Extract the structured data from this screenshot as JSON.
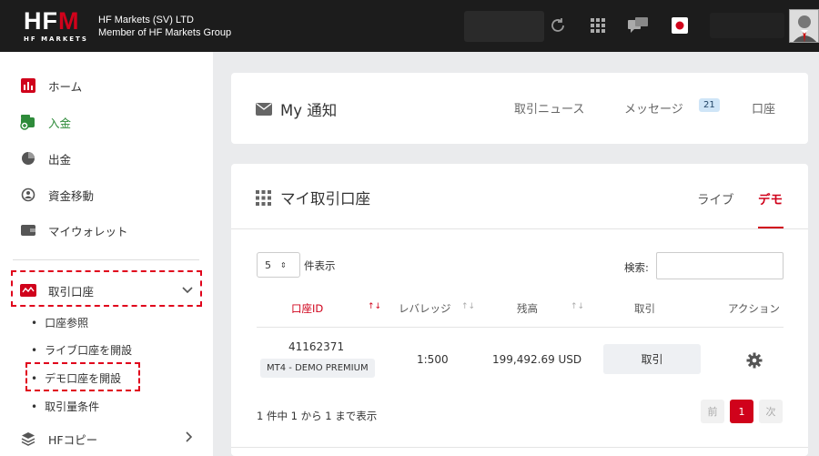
{
  "header": {
    "logo_text_main": "HFM",
    "logo_text_sub": "HF MARKETS",
    "company_line1": "HF Markets (SV) LTD",
    "company_line2": "Member of HF Markets Group",
    "icons": [
      "refresh-icon",
      "apps-grid-icon",
      "chat-icon",
      "japan-flag-icon",
      "avatar"
    ]
  },
  "sidebar": {
    "items": [
      {
        "label": "ホーム",
        "icon": "bar-chart-icon",
        "color": "#d0021b"
      },
      {
        "label": "入金",
        "icon": "deposit-icon",
        "color": "#2e8b3a"
      },
      {
        "label": "出金",
        "icon": "withdraw-icon",
        "color": "#555555"
      },
      {
        "label": "資金移動",
        "icon": "transfer-icon",
        "color": "#555555"
      },
      {
        "label": "マイウォレット",
        "icon": "wallet-icon",
        "color": "#555555"
      },
      {
        "label": "取引口座",
        "icon": "trading-account-icon",
        "color": "#d0021b"
      },
      {
        "label": "HFコピー",
        "icon": "layers-icon",
        "color": "#555555"
      }
    ],
    "subitems": [
      "口座参照",
      "ライブ口座を開設",
      "デモ口座を開設",
      "取引量条件"
    ]
  },
  "notifications": {
    "title": "My 通知",
    "tabs": [
      "取引ニュース",
      "メッセージ",
      "口座"
    ],
    "message_count": "21"
  },
  "accounts": {
    "title": "マイ取引口座",
    "tabs": [
      "ライブ",
      "デモ"
    ],
    "active_tab": "デモ",
    "page_size": "5",
    "page_size_label": "件表示",
    "search_label": "検索:",
    "search_value": "",
    "columns": [
      "口座ID",
      "レバレッジ",
      "残高",
      "取引",
      "アクション"
    ],
    "rows": [
      {
        "account_id": "41162371",
        "account_type": "MT4 - DEMO PREMIUM",
        "leverage": "1:500",
        "balance": "199,492.69 USD",
        "trade_label": "取引"
      }
    ],
    "summary": "1 件中 1 から 1 まで表示",
    "pagination": {
      "prev": "前",
      "current": "1",
      "next": "次"
    }
  },
  "colors": {
    "accent": "#d0021b",
    "topbar": "#1c1c1c",
    "highlight_box": "#e0001b"
  }
}
